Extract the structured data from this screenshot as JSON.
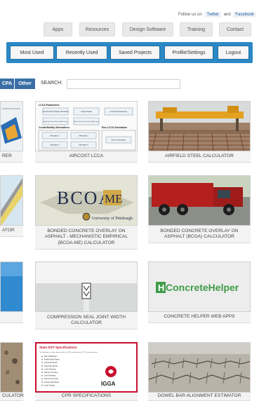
{
  "follow": {
    "text": "Follow us on",
    "twitter": "Twitter",
    "and": "and",
    "facebook": "Facebook"
  },
  "topnav": [
    "Apps",
    "Resources",
    "Design Software",
    "Training",
    "Contact"
  ],
  "usernav": [
    "Most Used",
    "Recently Used",
    "Saved Projects",
    "Profile/Settings",
    "Logout"
  ],
  "filters": {
    "pill1": "CPA",
    "pill2": "Other",
    "search_label": "SEARCH:",
    "search_value": ""
  },
  "cards": {
    "r1c0": "RER",
    "r1c1": "AIRCOST LCCA",
    "r1c2": "AIRFIELD STEEL CALCULATOR",
    "r2c0": "ATOR",
    "r2c1": "BONDED CONCRETE OVERLAY ON ASPHALT - MECHANISTIC EMPIRICAL (BCOA-ME) CALCULATOR",
    "r2c2": "BONDED CONCRETE OVERLAY ON ASPHALT (BCOA) CALCULATOR",
    "r3c0": "",
    "r3c1": "COMPRESSION SEAL JOINT WIDTH CALCULATOR",
    "r3c2": "CONCRETE HELPER WEB APPS",
    "r4c0": "CULATOR",
    "r4c1": "CPR SPECIFICATIONS",
    "r4c2": "DOWEL BAR ALIGNMENT ESTIMATOR"
  },
  "thumbs": {
    "aircost": {
      "h1": "LCCA Parameters",
      "b1": "General Airport Project Information",
      "b2": "Project Details",
      "b3": "LCC/LCCA Parameters",
      "b4": "Add Open Pave Drain & Add Comp",
      "b5": "Make Open Pave Drain & Add Comp",
      "h2": "Create/Modify Alternatives",
      "h3": "Run LCCA Simulation",
      "a1": "Alternative 1",
      "a2": "Alternative 2",
      "a3": "Alternative 3",
      "a4": "Alternative 4",
      "sim": "Execute Simulation"
    },
    "bcoame": {
      "logo": "BCOA",
      "sup": "ME",
      "uni": "University of Pittsburgh"
    },
    "helper": {
      "text": "ConcreteHelper",
      "mark": "H"
    },
    "cpr": {
      "title": "State DOT Specifications",
      "brand": "IGGA",
      "intro": "The following is a state-referenced list of CPR specifications for PCC pavement repair.",
      "items": [
        "Slab Stabilization",
        "Partial-Depth Repair",
        "Full-Depth Repair",
        "Dowel Bar Retrofit",
        "Cross-Stitching",
        "Diamond Grinding",
        "Joint Resealing",
        "Diamond Grooving",
        "Precast Slab Repair",
        "Crack Sealing"
      ]
    }
  },
  "colors": {
    "nav_blue": "#2c88c4",
    "pill_blue": "#3a6fa5",
    "helper_green": "#3f9b46",
    "cpr_red": "#c8102e"
  }
}
